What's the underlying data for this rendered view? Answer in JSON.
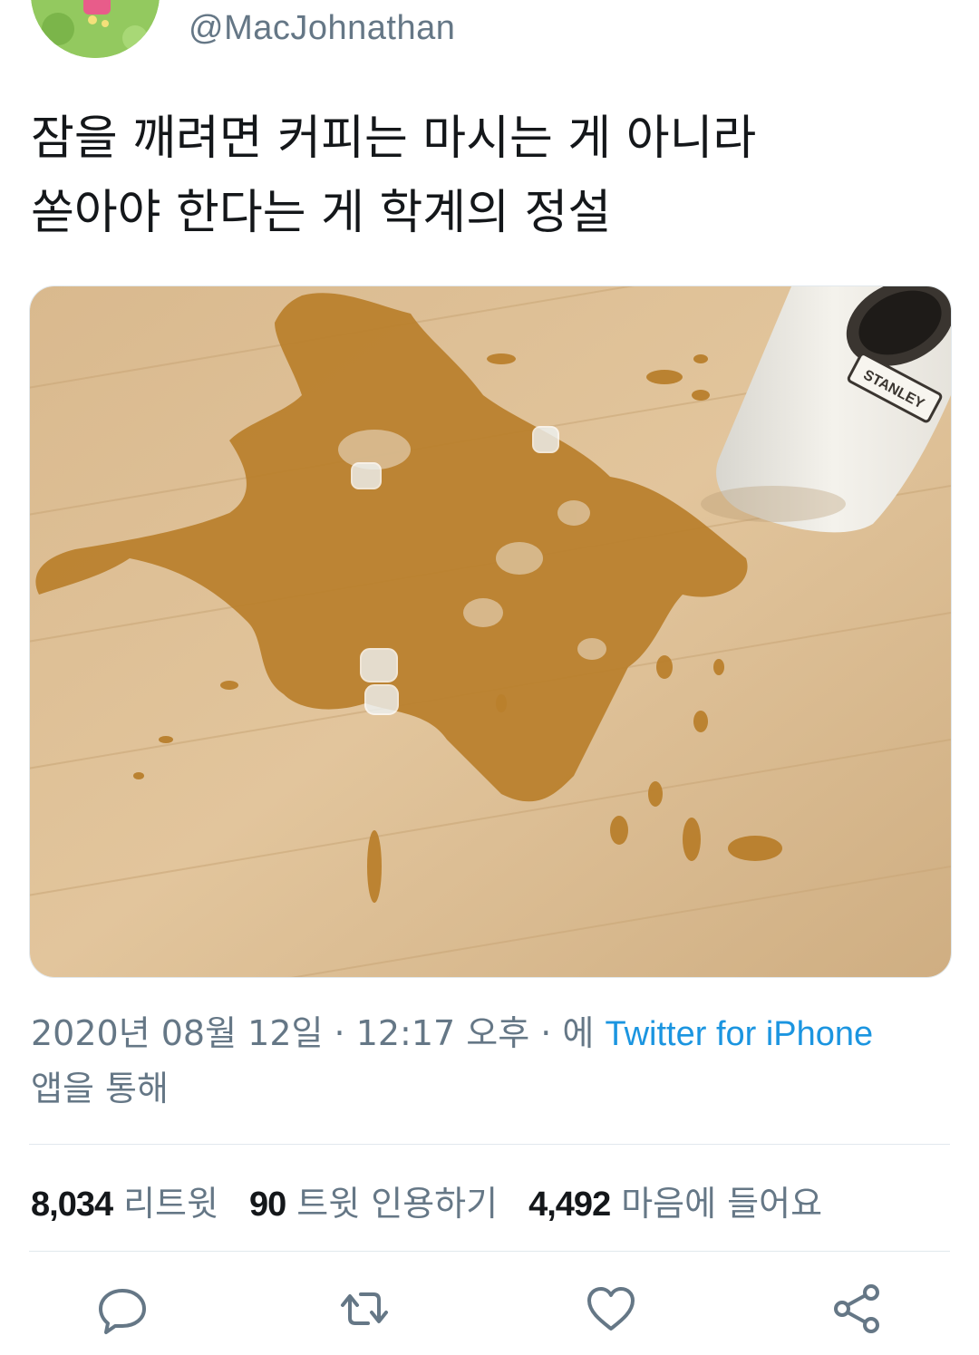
{
  "user": {
    "handle": "@MacJohnathan"
  },
  "tweet": {
    "text": "잠을 깨려면 커피는 마시는 게 아니라\n쏟아야 한다는 게 학계의 정설"
  },
  "meta": {
    "timestamp": "2020년 08월 12일 · 12:17 오후 · 에 ",
    "source": "Twitter for iPhone",
    "suffix": "앱을 통해"
  },
  "stats": {
    "retweets_count": "8,034",
    "retweets_label": "리트윗",
    "quotes_count": "90",
    "quotes_label": "트윗 인용하기",
    "likes_count": "4,492",
    "likes_label": "마음에 들어요"
  },
  "actions": {
    "reply_icon": "reply-icon",
    "retweet_icon": "retweet-icon",
    "like_icon": "heart-icon",
    "share_icon": "share-icon"
  },
  "media": {
    "cup_brand": "STANLEY"
  }
}
